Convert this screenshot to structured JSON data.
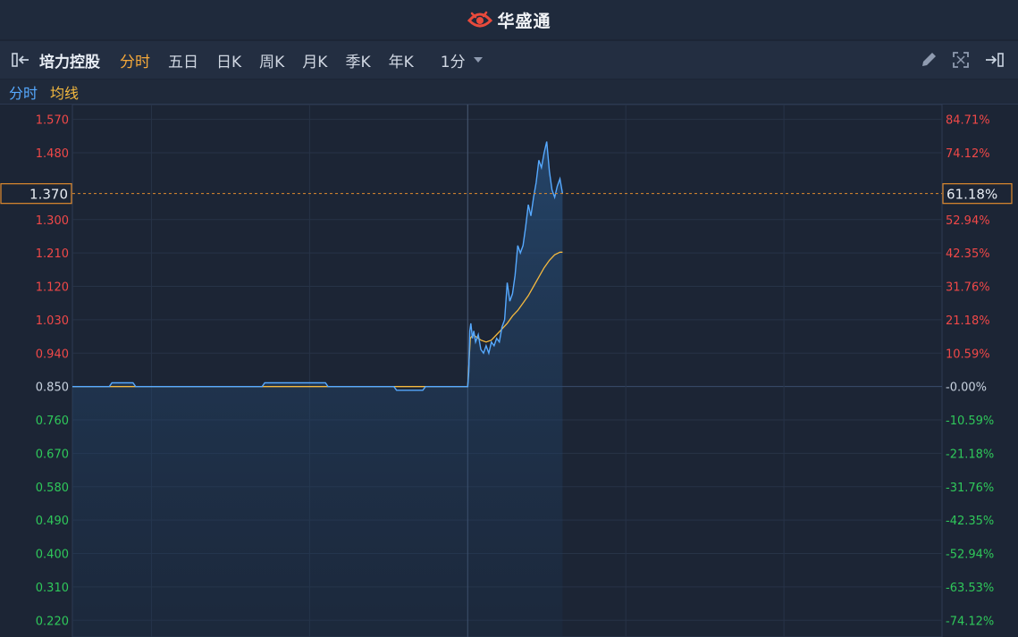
{
  "app": {
    "logo_text": "华盛通"
  },
  "toolbar": {
    "stock_name": "培力控股",
    "tabs": [
      "分时",
      "五日",
      "日K",
      "周K",
      "月K",
      "季K",
      "年K"
    ],
    "active_tab": 0,
    "interval": "1分"
  },
  "legend": {
    "line1": "分时",
    "line2": "均线"
  },
  "colors": {
    "price_line": "#56a9ff",
    "avg_line": "#f4b93f",
    "up": "#f04848",
    "down": "#2fc85a",
    "crosshair": "#e08a2e"
  },
  "chart_data": {
    "type": "line",
    "prev_close": 0.85,
    "ylim": [
      0.175,
      1.61
    ],
    "y_ticks": [
      {
        "price": 1.57,
        "label": "1.570",
        "pct": "84.71%"
      },
      {
        "price": 1.48,
        "label": "1.480",
        "pct": "74.12%"
      },
      {
        "price": 1.3,
        "label": "1.300",
        "pct": "52.94%"
      },
      {
        "price": 1.21,
        "label": "1.210",
        "pct": "42.35%"
      },
      {
        "price": 1.12,
        "label": "1.120",
        "pct": "31.76%"
      },
      {
        "price": 1.03,
        "label": "1.030",
        "pct": "21.18%"
      },
      {
        "price": 0.94,
        "label": "0.940",
        "pct": "10.59%"
      },
      {
        "price": 0.85,
        "label": "0.850",
        "pct": "-0.00%"
      },
      {
        "price": 0.76,
        "label": "0.760",
        "pct": "-10.59%"
      },
      {
        "price": 0.67,
        "label": "0.670",
        "pct": "-21.18%"
      },
      {
        "price": 0.58,
        "label": "0.580",
        "pct": "-31.76%"
      },
      {
        "price": 0.49,
        "label": "0.490",
        "pct": "-42.35%"
      },
      {
        "price": 0.4,
        "label": "0.400",
        "pct": "-52.94%"
      },
      {
        "price": 0.31,
        "label": "0.310",
        "pct": "-63.53%"
      },
      {
        "price": 0.22,
        "label": "0.220",
        "pct": "-74.12%"
      }
    ],
    "crosshair": {
      "price": 1.37,
      "label": "1.370",
      "pct": "61.18%"
    },
    "x_range": [
      0,
      330
    ],
    "x_grid": [
      30,
      90,
      150,
      210,
      270
    ],
    "series": [
      {
        "key": "price",
        "x": [
          0,
          14,
          15,
          23,
          24,
          72,
          73,
          96,
          97,
          122,
          123,
          133,
          134,
          150,
          150.4,
          150.8,
          151.2,
          151.8,
          152.3,
          153,
          154,
          155,
          156,
          157,
          158,
          159,
          160,
          161,
          162,
          163,
          164,
          165,
          166,
          167,
          168,
          169,
          170,
          171,
          172,
          173,
          174,
          175,
          176,
          177,
          178,
          179,
          180,
          181,
          182,
          183,
          184,
          185,
          186
        ],
        "y": [
          0.85,
          0.85,
          0.86,
          0.86,
          0.85,
          0.85,
          0.86,
          0.86,
          0.85,
          0.85,
          0.84,
          0.84,
          0.85,
          0.85,
          0.89,
          1.0,
          1.02,
          0.98,
          1.0,
          0.97,
          0.99,
          0.95,
          0.94,
          0.96,
          0.94,
          0.97,
          0.96,
          0.98,
          0.97,
          1.01,
          1.03,
          1.13,
          1.08,
          1.1,
          1.15,
          1.23,
          1.21,
          1.23,
          1.28,
          1.34,
          1.31,
          1.36,
          1.4,
          1.46,
          1.44,
          1.48,
          1.51,
          1.43,
          1.38,
          1.36,
          1.39,
          1.41,
          1.37
        ]
      },
      {
        "key": "avg",
        "x": [
          0,
          150,
          151,
          152,
          153,
          155,
          157,
          159,
          161,
          163,
          165,
          167,
          169,
          171,
          173,
          175,
          177,
          179,
          181,
          183,
          185,
          186
        ],
        "y": [
          0.85,
          0.85,
          0.98,
          0.99,
          0.985,
          0.975,
          0.97,
          0.975,
          0.99,
          1.005,
          1.02,
          1.04,
          1.055,
          1.075,
          1.095,
          1.12,
          1.145,
          1.17,
          1.19,
          1.205,
          1.212,
          1.212
        ]
      }
    ]
  }
}
